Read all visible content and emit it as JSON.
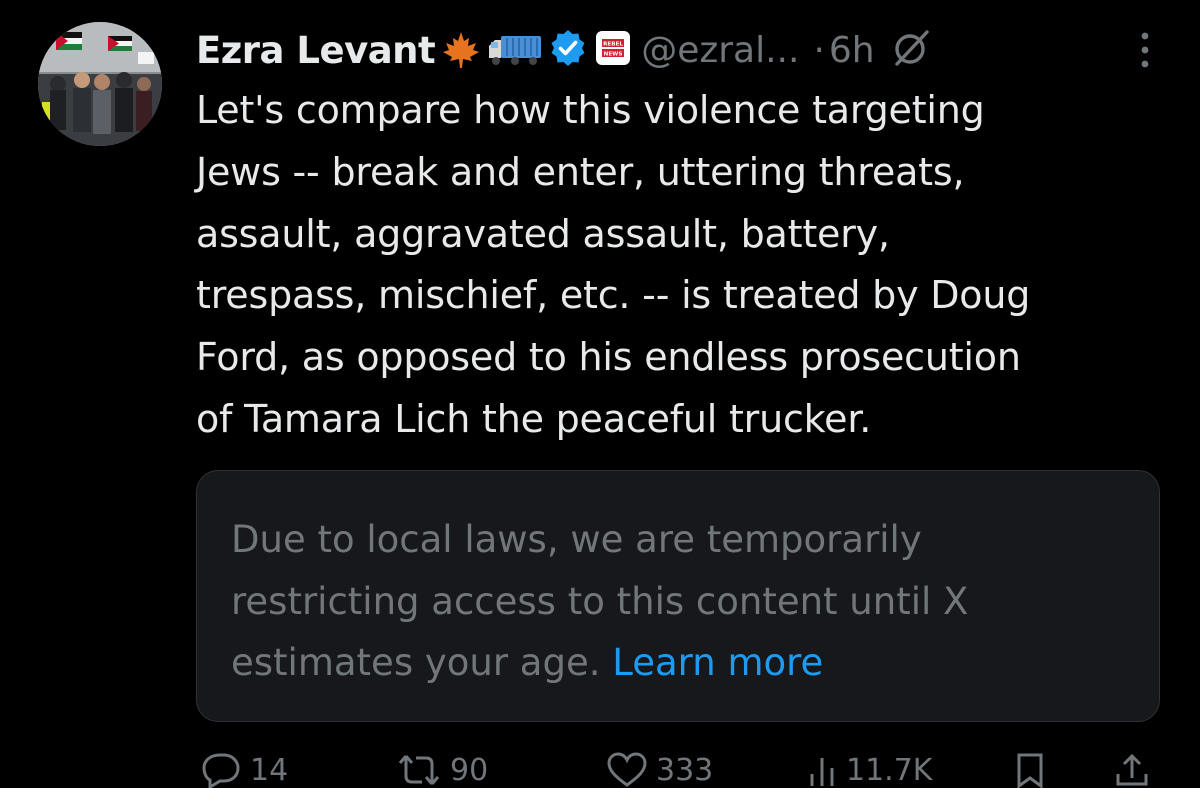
{
  "author": {
    "display_name": "Ezra Levant",
    "handle": "@ezral...",
    "separator": "·",
    "time": "6h",
    "badges": [
      "maple-leaf-emoji",
      "truck-emoji",
      "verified-badge",
      "rebel-news-affiliate"
    ],
    "affiliate_label": "REBEL NEWS"
  },
  "tweet": {
    "text": "Let's compare how this violence targeting\nJews -- break and enter, uttering threats,\nassault, aggravated assault, battery,\ntrespass, mischief, etc. -- is treated by Doug\nFord, as opposed to his endless prosecution\nof Tamara Lich the peaceful trucker."
  },
  "notice": {
    "text": "Due to local laws, we are temporarily\nrestricting access to this content until X\nestimates your age. ",
    "link_label": "Learn more"
  },
  "actions": {
    "replies": "14",
    "reposts": "90",
    "likes": "333",
    "views": "11.7K"
  },
  "colors": {
    "background": "#000000",
    "primary_text": "#e7e9ea",
    "secondary_text": "#71767b",
    "link": "#1d9bf0",
    "card_bg": "#16181c",
    "verified": "#1d9bf0"
  }
}
